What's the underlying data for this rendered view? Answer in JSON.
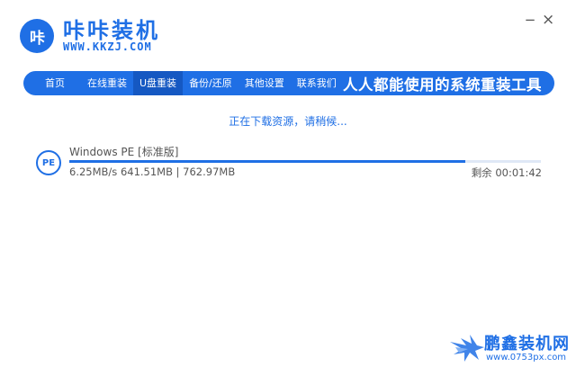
{
  "app": {
    "logo_text": "咔",
    "title": "咔咔装机",
    "url": "WWW.KKZJ.COM",
    "minimize_glyph": "−",
    "close_glyph": "×"
  },
  "nav": {
    "items": [
      {
        "label": "首页"
      },
      {
        "label": "在线重装"
      },
      {
        "label": "U盘重装"
      },
      {
        "label": "备份/还原"
      },
      {
        "label": "其他设置"
      },
      {
        "label": "联系我们"
      }
    ],
    "active_index": 2,
    "slogan": "人人都能使用的系统重装工具"
  },
  "status": "正在下载资源，请稍候...",
  "download": {
    "icon_text": "PE",
    "name": "Windows PE [标准版]",
    "speed": "6.25MB/s",
    "downloaded": "641.51MB",
    "total": "762.97MB",
    "progress_text": "6.25MB/s 641.51MB | 762.97MB",
    "progress_fraction": 0.84,
    "remaining": "剩余 00:01:42"
  },
  "watermark": {
    "title": "鹏鑫装机网",
    "url": "www.0753px.com"
  },
  "colors": {
    "accent": "#1f6fe5",
    "active_tab": "#1558c2",
    "track": "#dfe8f6"
  }
}
